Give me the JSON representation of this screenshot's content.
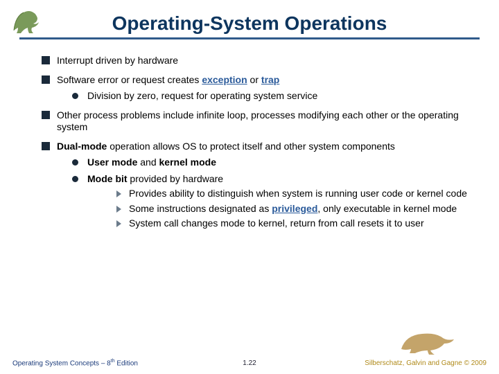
{
  "title": "Operating-System Operations",
  "bullets": {
    "b1_1": "Interrupt driven by hardware",
    "b1_2_pre": "Software error or request creates ",
    "b1_2_kw1": "exception",
    "b1_2_mid": " or ",
    "b1_2_kw2": "trap",
    "b2_1": "Division by zero, request for operating system service",
    "b1_3": "Other process problems include infinite loop, processes modifying each other or the operating system",
    "b1_4_kw": "Dual-mode",
    "b1_4_post": " operation allows OS to protect itself and other system components",
    "b2_2_kw1": "User mode",
    "b2_2_mid": " and ",
    "b2_2_kw2": "kernel mode",
    "b2_3_kw": "Mode bit",
    "b2_3_post": " provided by hardware",
    "b3_1": "Provides ability to distinguish when system is running user code or kernel code",
    "b3_2_pre": "Some instructions designated as ",
    "b3_2_kw": "privileged",
    "b3_2_post": ", only executable in kernel mode",
    "b3_3": "System call changes mode to kernel, return from call resets it to user"
  },
  "footer": {
    "left_a": "Operating System Concepts – 8",
    "left_sup": "th",
    "left_b": " Edition",
    "center": "1.22",
    "right": "Silberschatz, Galvin and Gagne © 2009"
  }
}
